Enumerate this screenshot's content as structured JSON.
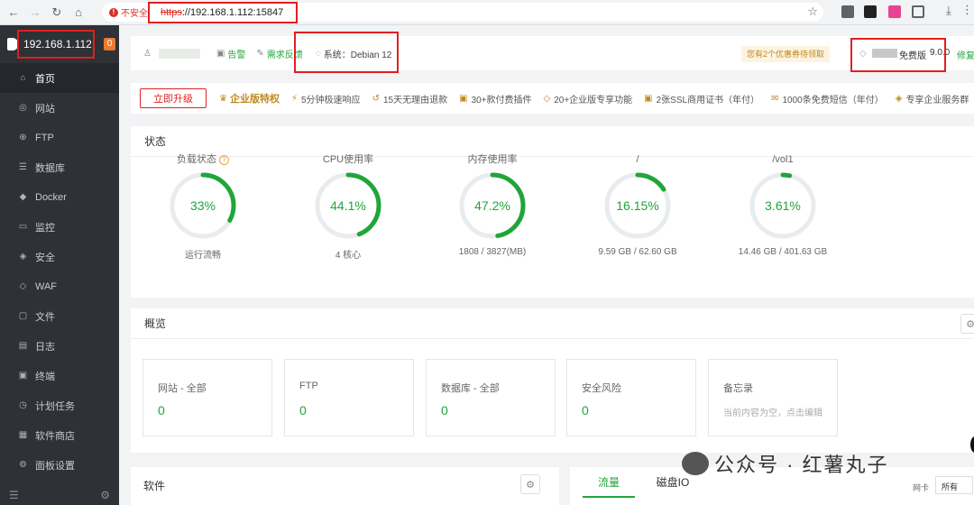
{
  "browser": {
    "insecure_label": "不安全",
    "url_proto": "https",
    "url_rest": "://192.168.1.112:15847"
  },
  "sidebar": {
    "host": "192.168.1.112",
    "badge": "0",
    "items": [
      {
        "label": "首页",
        "icon": "home-icon",
        "glyph": "⌂"
      },
      {
        "label": "网站",
        "icon": "globe-icon",
        "glyph": "◎"
      },
      {
        "label": "FTP",
        "icon": "ftp-icon",
        "glyph": "⊕"
      },
      {
        "label": "数据库",
        "icon": "database-icon",
        "glyph": "☰"
      },
      {
        "label": "Docker",
        "icon": "docker-icon",
        "glyph": "◆"
      },
      {
        "label": "监控",
        "icon": "monitor-icon",
        "glyph": "▭"
      },
      {
        "label": "安全",
        "icon": "shield-icon",
        "glyph": "◈"
      },
      {
        "label": "WAF",
        "icon": "waf-icon",
        "glyph": "◇"
      },
      {
        "label": "文件",
        "icon": "folder-icon",
        "glyph": "▢"
      },
      {
        "label": "日志",
        "icon": "log-icon",
        "glyph": "▤"
      },
      {
        "label": "终端",
        "icon": "terminal-icon",
        "glyph": "▣"
      },
      {
        "label": "计划任务",
        "icon": "clock-icon",
        "glyph": "◷"
      },
      {
        "label": "软件商店",
        "icon": "apps-icon",
        "glyph": "▦"
      },
      {
        "label": "面板设置",
        "icon": "gear-icon",
        "glyph": "⚙"
      }
    ]
  },
  "topbar": {
    "alert": "告警",
    "feedback": "需求反馈",
    "system": "系统：Debian 12",
    "coupon": "您有2个优惠券待领取",
    "free_edition": "免费版",
    "version": "9.0.0",
    "repair": "修复"
  },
  "promo": {
    "upgrade": "立即升级",
    "vip": "企业版特权",
    "features": [
      "5分钟极速响应",
      "15天无理由退款",
      "30+款付费插件",
      "20+企业版专享功能",
      "2张SSL商用证书（年付）",
      "1000条免费短信（年付）",
      "专享企业服务群"
    ]
  },
  "status": {
    "title": "状态",
    "gauges": [
      {
        "label": "负载状态",
        "value": "33%",
        "pct": 33,
        "sub": "运行流畅"
      },
      {
        "label": "CPU使用率",
        "value": "44.1%",
        "pct": 44.1,
        "sub": "4 核心"
      },
      {
        "label": "内存使用率",
        "value": "47.2%",
        "pct": 47.2,
        "sub": "1808 / 3827(MB)"
      },
      {
        "label": "/",
        "value": "16.15%",
        "pct": 16.15,
        "sub": "9.59 GB / 62.60 GB"
      },
      {
        "label": "/vol1",
        "value": "3.61%",
        "pct": 3.61,
        "sub": "14.46 GB / 401.63 GB"
      }
    ]
  },
  "overview": {
    "title": "概览",
    "cards": [
      {
        "title": "网站 - 全部",
        "value": "0"
      },
      {
        "title": "FTP",
        "value": "0"
      },
      {
        "title": "数据库 - 全部",
        "value": "0"
      },
      {
        "title": "安全风险",
        "value": "0"
      }
    ],
    "memo_title": "备忘录",
    "memo_note": "当前内容为空，点击编辑"
  },
  "software": {
    "title": "软件"
  },
  "traffic": {
    "tab_traffic": "流量",
    "tab_disk": "磁盘IO",
    "nic_label": "网卡",
    "nic_value": "所有"
  },
  "watermark": "公众号 · 红薯丸子",
  "colors": {
    "accent": "#20a53a",
    "warning": "#e02020",
    "gold": "#c08a1f"
  }
}
